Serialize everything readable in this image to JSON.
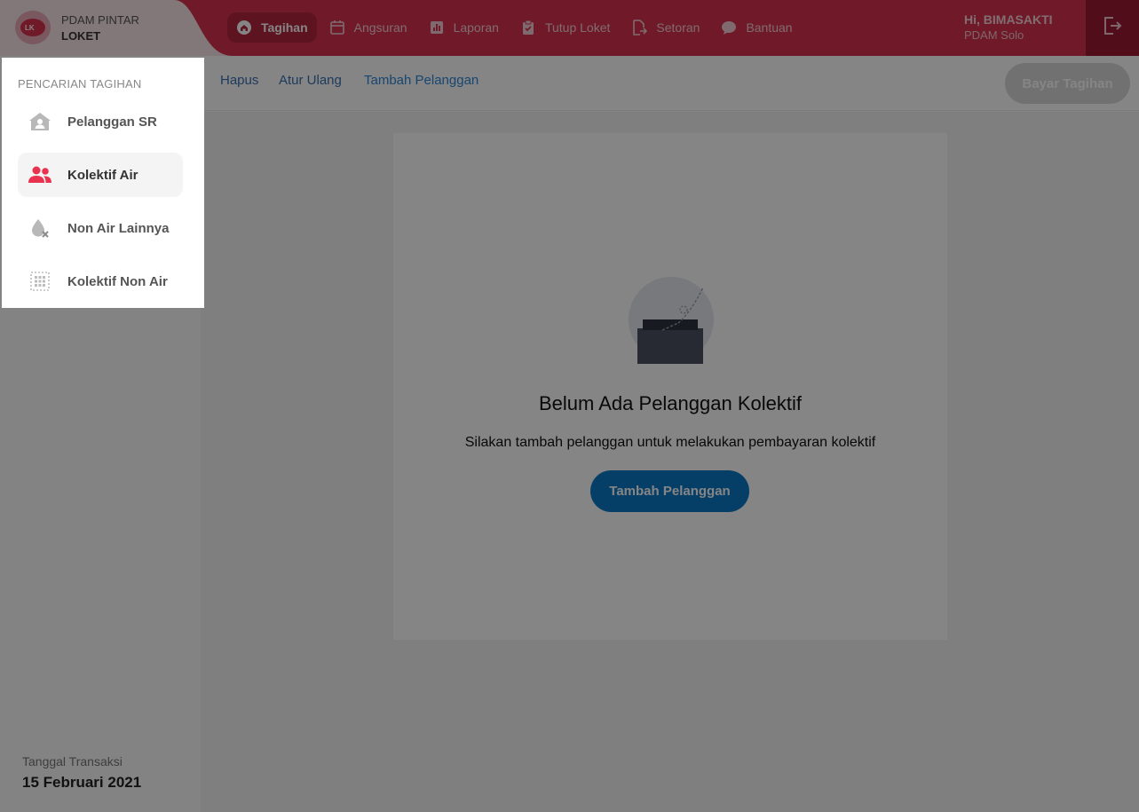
{
  "app": {
    "brand_line1": "PDAM PINTAR",
    "brand_line2": "LOKET",
    "logo_text": "LK"
  },
  "nav": [
    {
      "label": "Tagihan",
      "icon": "home-icon",
      "active": true
    },
    {
      "label": "Angsuran",
      "icon": "calendar-icon",
      "active": false
    },
    {
      "label": "Laporan",
      "icon": "chart-icon",
      "active": false
    },
    {
      "label": "Tutup Loket",
      "icon": "clipboard-check-icon",
      "active": false
    },
    {
      "label": "Setoran",
      "icon": "file-export-icon",
      "active": false
    },
    {
      "label": "Bantuan",
      "icon": "chat-icon",
      "active": false
    }
  ],
  "user": {
    "greeting": "Hi, BIMASAKTI",
    "org": "PDAM Solo"
  },
  "toolbar": {
    "hapus": "Hapus",
    "atur_ulang": "Atur Ulang",
    "tambah_pelanggan": "Tambah Pelanggan",
    "bayar_tagihan": "Bayar Tagihan"
  },
  "menu": {
    "heading": "PENCARIAN TAGIHAN",
    "items": [
      {
        "label": "Pelanggan SR",
        "icon": "house-user-icon",
        "active": false
      },
      {
        "label": "Kolektif Air",
        "icon": "users-icon",
        "active": true
      },
      {
        "label": "Non Air Lainnya",
        "icon": "water-drop-off-icon",
        "active": false
      },
      {
        "label": "Kolektif Non Air",
        "icon": "grid-dots-icon",
        "active": false
      }
    ]
  },
  "empty_state": {
    "title": "Belum Ada Pelanggan Kolektif",
    "subtitle": "Silakan tambah pelanggan untuk melakukan pembayaran kolektif",
    "button": "Tambah Pelanggan"
  },
  "footer": {
    "date_label": "Tanggal Transaksi",
    "date_value": "15 Februari 2021"
  },
  "colors": {
    "brand_red": "#d7334f",
    "menu_active_icon": "#e8324f",
    "primary_blue": "#0b7ac8"
  }
}
